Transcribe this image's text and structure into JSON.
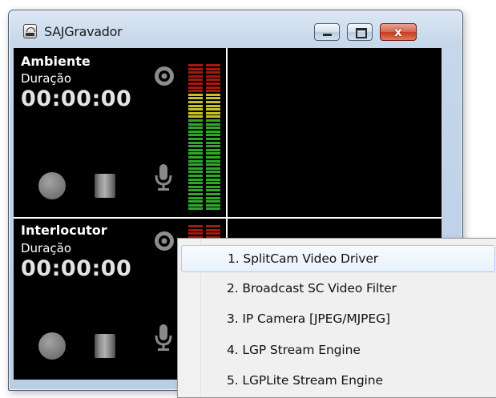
{
  "window": {
    "title": "SAJGravador",
    "icon": "app-recorder-icon",
    "controls": {
      "minimize": "minimize-icon",
      "maximize": "maximize-icon",
      "close_glyph": "x"
    }
  },
  "panels": [
    {
      "title": "Ambiente",
      "duration_label": "Duração",
      "timer": "00:00:00",
      "icons": [
        "camera-lens-icon",
        "record-icon",
        "stop-icon",
        "microphone-icon"
      ]
    },
    {
      "title": "Interlocutor",
      "duration_label": "Duração",
      "timer": "00:00:00",
      "icons": [
        "camera-lens-icon",
        "record-icon",
        "stop-icon",
        "microphone-icon"
      ]
    }
  ],
  "context_menu": {
    "items": [
      {
        "label": "1. SplitCam Video Driver",
        "highlighted": true
      },
      {
        "label": "2. Broadcast SC Video Filter",
        "highlighted": false
      },
      {
        "label": "3. IP Camera [JPEG/MJPEG]",
        "highlighted": false
      },
      {
        "label": "4. LGP Stream Engine",
        "highlighted": false
      },
      {
        "label": "5. LGPLite Stream Engine",
        "highlighted": false
      }
    ]
  },
  "colors": {
    "vu_red": "#a01a10",
    "vu_yellow": "#c8c020",
    "vu_green": "#2fa82a",
    "panel_bg": "#000000",
    "menu_highlight_border": "#aeccee"
  }
}
